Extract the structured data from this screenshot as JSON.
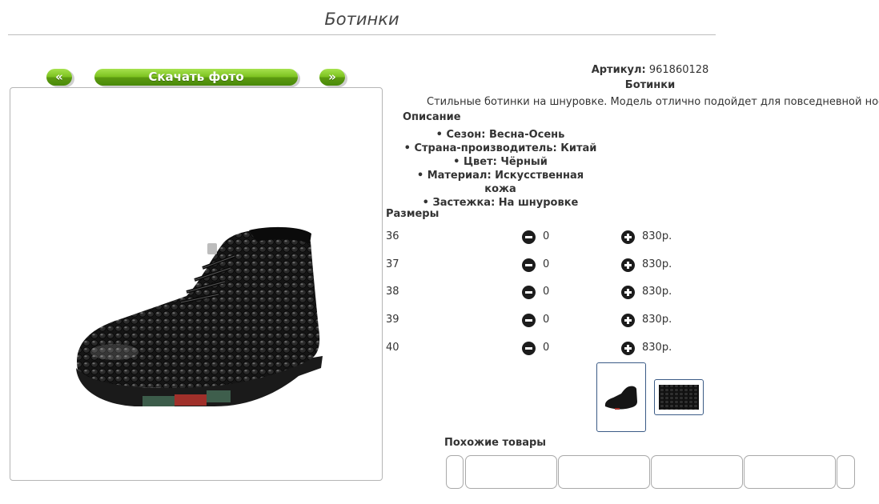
{
  "page": {
    "title": "Ботинки"
  },
  "gallery": {
    "prev_label": "«",
    "download_label": "Скачать фото",
    "next_label": "»"
  },
  "product": {
    "article_label": "Артикул:",
    "article_value": "961860128",
    "name": "Ботинки",
    "short_description": "Стильные ботинки на шнуровке. Модель отлично подойдет для повседневной носки",
    "description_heading": "Описание",
    "features": [
      "Сезон: Весна-Осень",
      "Страна-производитель: Китай",
      "Цвет: Чёрный",
      "Материал: Искусственная кожа",
      "Застежка: На шнуровке"
    ]
  },
  "sizes": {
    "heading": "Размеры",
    "rows": [
      {
        "size": "36",
        "qty": "0",
        "price": "830р."
      },
      {
        "size": "37",
        "qty": "0",
        "price": "830р."
      },
      {
        "size": "38",
        "qty": "0",
        "price": "830р."
      },
      {
        "size": "39",
        "qty": "0",
        "price": "830р."
      },
      {
        "size": "40",
        "qty": "0",
        "price": "830р."
      }
    ]
  },
  "similar": {
    "heading": "Похожие товары"
  },
  "colors": {
    "accent_green": "#7cc21f",
    "thumb_border": "#3b5b86",
    "text": "#333333"
  },
  "icons": {
    "minus": "minus-circle-icon",
    "plus": "plus-circle-icon"
  }
}
